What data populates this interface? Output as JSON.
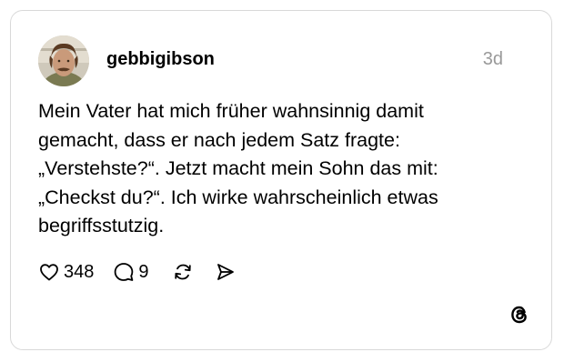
{
  "post": {
    "username": "gebbigibson",
    "timestamp": "3d",
    "text_lines": [
      "Mein Vater hat mich früher wahnsinnig damit",
      "gemacht, dass er nach jedem Satz fragte:",
      "„Verstehste?“. Jetzt macht mein Sohn das mit:",
      "„Checkst du?“. Ich wirke wahrscheinlich etwas",
      "begriffsstutzig."
    ]
  },
  "actions": {
    "likes": "348",
    "replies": "9",
    "like_icon": "heart-icon",
    "reply_icon": "speech-bubble-icon",
    "repost_icon": "repost-icon",
    "share_icon": "send-icon"
  },
  "branding": {
    "logo_icon": "threads-logo-icon"
  },
  "colors": {
    "text": "#000000",
    "muted": "#999999",
    "border": "#d9d9d9"
  }
}
